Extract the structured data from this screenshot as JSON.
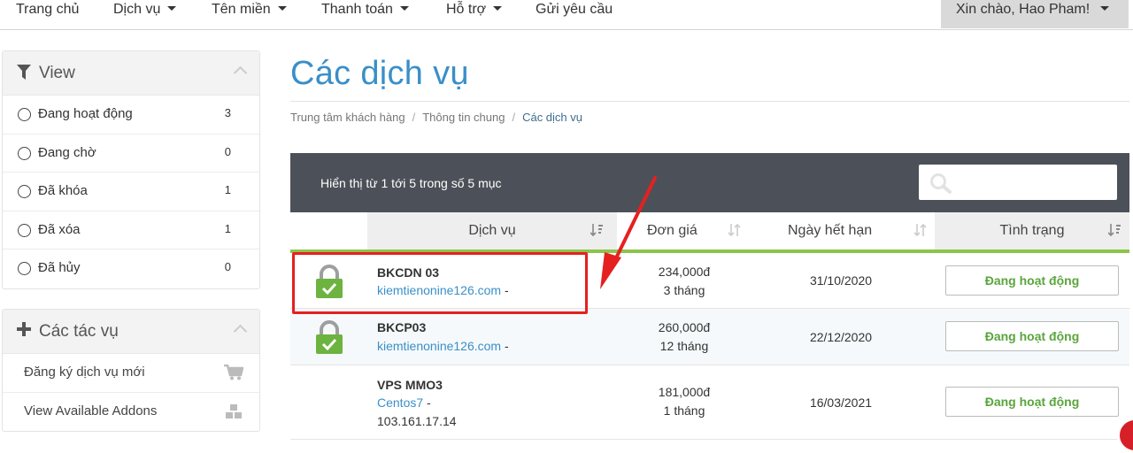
{
  "nav": {
    "items": [
      {
        "label": "Trang chủ",
        "dropdown": false
      },
      {
        "label": "Dịch vụ",
        "dropdown": true
      },
      {
        "label": "Tên miền",
        "dropdown": true
      },
      {
        "label": "Thanh toán",
        "dropdown": true
      },
      {
        "label": "Hỗ trợ",
        "dropdown": true
      },
      {
        "label": "Gửi yêu cầu",
        "dropdown": false
      }
    ],
    "user_greeting": "Xin chào, Hao Pham!"
  },
  "sidebar": {
    "view_panel": {
      "title": "View",
      "icon": "filter-icon",
      "items": [
        {
          "label": "Đang hoạt động",
          "count": "3"
        },
        {
          "label": "Đang chờ",
          "count": "0"
        },
        {
          "label": "Đã khóa",
          "count": "1"
        },
        {
          "label": "Đã xóa",
          "count": "1"
        },
        {
          "label": "Đã hủy",
          "count": "0"
        }
      ]
    },
    "actions_panel": {
      "title": "Các tác vụ",
      "icon": "plus-icon",
      "items": [
        {
          "label": "Đăng ký dịch vụ mới",
          "icon": "cart-icon"
        },
        {
          "label": "View Available Addons",
          "icon": "cubes-icon"
        }
      ]
    }
  },
  "main": {
    "title": "Các dịch vụ",
    "breadcrumb": [
      "Trung tâm khách hàng",
      "Thông tin chung",
      "Các dịch vụ"
    ],
    "table_info": "Hiển thị từ 1 tới 5 trong số 5 mục",
    "search": {
      "placeholder": "",
      "value": ""
    },
    "columns": [
      "Dịch vụ",
      "Đơn giá",
      "Ngày hết hạn",
      "Tình trạng"
    ],
    "rows": [
      {
        "name": "BKCDN 03",
        "domain": "kiemtienonine126.com",
        "suffix": " -",
        "extra": "",
        "price": "234,000đ",
        "cycle": "3 tháng",
        "due": "31/10/2020",
        "status": "Đang hoạt động",
        "ssl": true
      },
      {
        "name": "BKCP03",
        "domain": "kiemtienonine126.com",
        "suffix": " -",
        "extra": "",
        "price": "260,000đ",
        "cycle": "12 tháng",
        "due": "22/12/2020",
        "status": "Đang hoạt động",
        "ssl": true
      },
      {
        "name": "VPS MMO3",
        "domain": "Centos7",
        "suffix": " -",
        "extra": "103.161.17.14",
        "price": "181,000đ",
        "cycle": "1 tháng",
        "due": "16/03/2021",
        "status": "Đang hoạt động",
        "ssl": false
      }
    ]
  },
  "colors": {
    "accent": "#3a8fc8",
    "status_green": "#5aa53c",
    "header_underline": "#8cc54a",
    "toolbar": "#4c5159",
    "annotation_red": "#e52020"
  }
}
